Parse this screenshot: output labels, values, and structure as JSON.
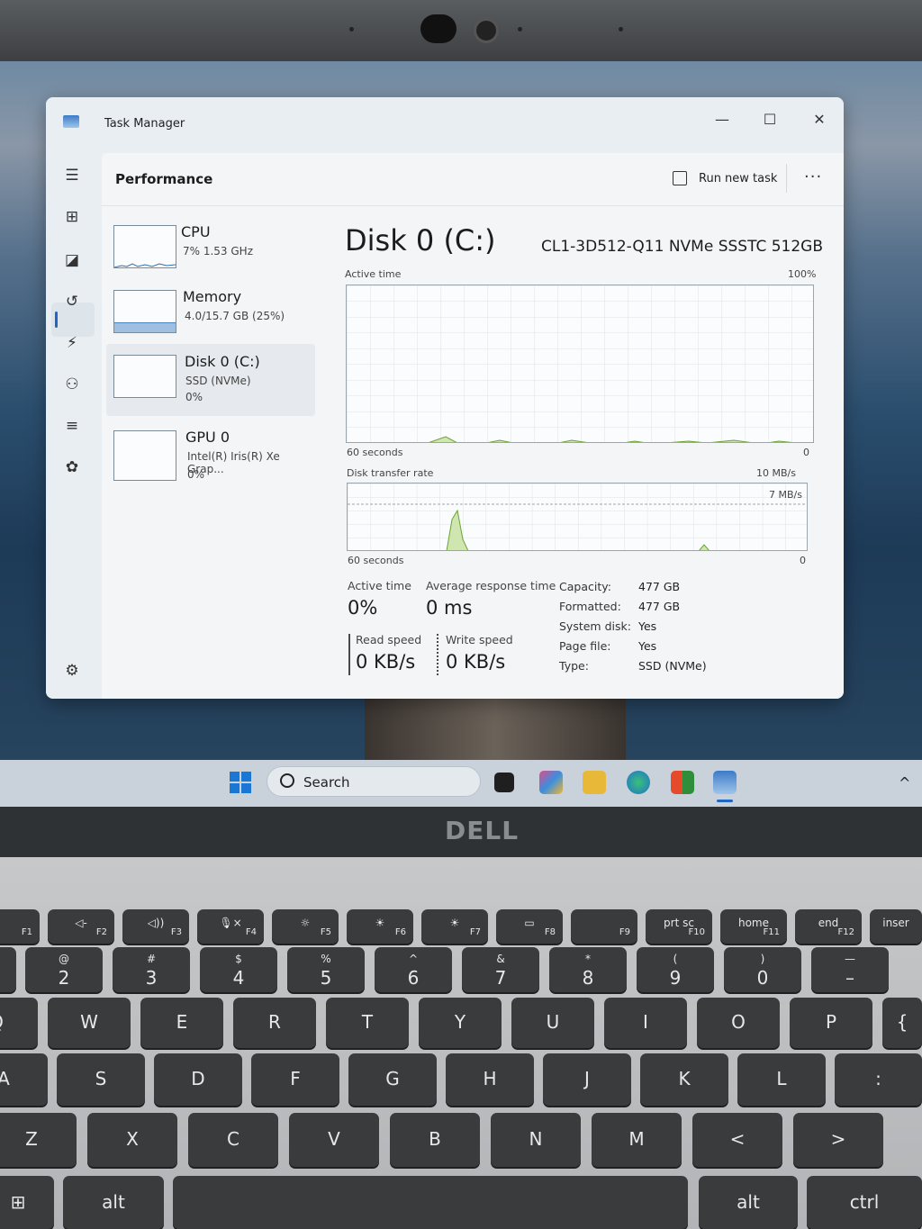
{
  "window": {
    "app_title": "Task Manager",
    "minimize": "—",
    "maximize": "☐",
    "close": "✕"
  },
  "header": {
    "title": "Performance",
    "run_task": "Run new task",
    "more": "···"
  },
  "devices": [
    {
      "name": "CPU",
      "sub": "7%  1.53 GHz",
      "sub2": ""
    },
    {
      "name": "Memory",
      "sub": "4.0/15.7 GB (25%)",
      "sub2": ""
    },
    {
      "name": "Disk 0 (C:)",
      "sub": "SSD (NVMe)",
      "sub2": "0%"
    },
    {
      "name": "GPU 0",
      "sub": "Intel(R) Iris(R) Xe Grap...",
      "sub2": "0%"
    }
  ],
  "main": {
    "title": "Disk 0 (C:)",
    "model": "CL1-3D512-Q11 NVMe SSSTC 512GB",
    "active_label": "Active time",
    "active_max": "100%",
    "active_span": "60 seconds",
    "active_min": "0",
    "transfer_label": "Disk transfer rate",
    "transfer_max": "10 MB/s",
    "transfer_ref": "7 MB/s",
    "transfer_span": "60 seconds",
    "transfer_min": "0"
  },
  "stats": {
    "active_time_label": "Active time",
    "active_time_value": "0%",
    "avg_resp_label": "Average response time",
    "avg_resp_value": "0 ms",
    "read_label": "Read speed",
    "read_value": "0 KB/s",
    "write_label": "Write speed",
    "write_value": "0 KB/s"
  },
  "properties": [
    {
      "k": "Capacity:",
      "v": "477 GB"
    },
    {
      "k": "Formatted:",
      "v": "477 GB"
    },
    {
      "k": "System disk:",
      "v": "Yes"
    },
    {
      "k": "Page file:",
      "v": "Yes"
    },
    {
      "k": "Type:",
      "v": "SSD (NVMe)"
    }
  ],
  "taskbar": {
    "search_label": "Search",
    "tray_chevron": "^"
  },
  "brand": "DELL",
  "keyboard": {
    "fn_row": [
      {
        "t": "",
        "l": "F1"
      },
      {
        "t": "◁-",
        "l": "F2"
      },
      {
        "t": "◁))",
        "l": "F3"
      },
      {
        "t": "🎙×",
        "l": "F4"
      },
      {
        "t": "☼",
        "l": "F5"
      },
      {
        "t": "☀",
        "l": "F6"
      },
      {
        "t": "☀",
        "l": "F7"
      },
      {
        "t": "▭",
        "l": "F8"
      },
      {
        "t": "",
        "l": "F9"
      },
      {
        "t": "prt sc",
        "l": "F10"
      },
      {
        "t": "home",
        "l": "F11"
      },
      {
        "t": "end",
        "l": "F12"
      },
      {
        "t": "inser",
        "l": ""
      }
    ],
    "num_row": [
      {
        "t": "@",
        "l": "2"
      },
      {
        "t": "#",
        "l": "3"
      },
      {
        "t": "$",
        "l": "4"
      },
      {
        "t": "%",
        "l": "5"
      },
      {
        "t": "^",
        "l": "6"
      },
      {
        "t": "&",
        "l": "7"
      },
      {
        "t": "*",
        "l": "8"
      },
      {
        "t": "(",
        "l": "9"
      },
      {
        "t": ")",
        "l": "0"
      },
      {
        "t": "—",
        "l": "–"
      }
    ],
    "row_q": [
      "Q",
      "W",
      "E",
      "R",
      "T",
      "Y",
      "U",
      "I",
      "O",
      "P",
      "{"
    ],
    "row_a": [
      "A",
      "S",
      "D",
      "F",
      "G",
      "H",
      "J",
      "K",
      "L",
      ":"
    ],
    "row_z": [
      "Z",
      "X",
      "C",
      "V",
      "B",
      "N",
      "M",
      "<",
      ">"
    ],
    "row_b": {
      "alt_left": "alt",
      "alt_right": "alt",
      "ctrl": "ctrl"
    }
  }
}
